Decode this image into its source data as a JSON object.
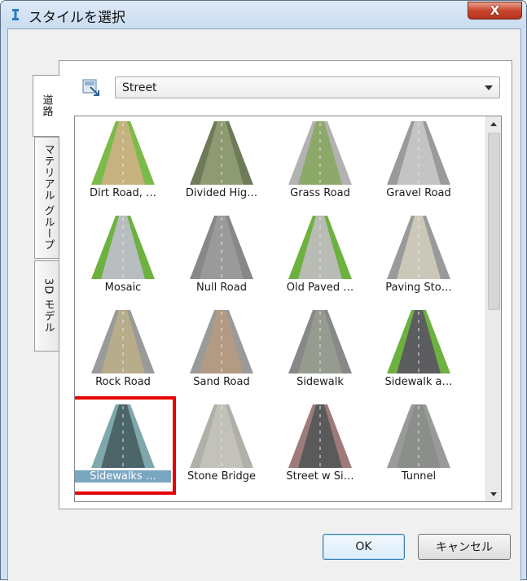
{
  "window": {
    "title": "スタイルを選択",
    "close_label": "X"
  },
  "tabs": [
    {
      "label": "道路",
      "active": true
    },
    {
      "label": "マテリアル グループ",
      "active": false
    },
    {
      "label": "3D モデル",
      "active": false
    }
  ],
  "category": {
    "selected": "Street"
  },
  "styles": [
    {
      "label": "Dirt Road, …",
      "selected": false,
      "center": "#c6b27e",
      "shoulder": "#7bbb4a"
    },
    {
      "label": "Divided Hig…",
      "selected": false,
      "center": "#8e9a72",
      "shoulder": "#6e7a58"
    },
    {
      "label": "Grass Road",
      "selected": false,
      "center": "#8da96a",
      "shoulder": "#b2b2b2"
    },
    {
      "label": "Gravel Road",
      "selected": false,
      "center": "#c3c3c3",
      "shoulder": "#9a9a9a"
    },
    {
      "label": "Mosaic",
      "selected": false,
      "center": "#b8bdbf",
      "shoulder": "#6db13f"
    },
    {
      "label": "Null Road",
      "selected": false,
      "center": "#9a9a9a",
      "shoulder": "#888888"
    },
    {
      "label": "Old Paved …",
      "selected": false,
      "center": "#b9bbb5",
      "shoulder": "#6db13f"
    },
    {
      "label": "Paving Sto…",
      "selected": false,
      "center": "#cbc8b9",
      "shoulder": "#9a9a9a"
    },
    {
      "label": "Rock Road",
      "selected": false,
      "center": "#b8ad8a",
      "shoulder": "#9a9a9a"
    },
    {
      "label": "Sand Road",
      "selected": false,
      "center": "#b39a82",
      "shoulder": "#9a9a9a"
    },
    {
      "label": "Sidewalk",
      "selected": false,
      "center": "#969b8f",
      "shoulder": "#888888"
    },
    {
      "label": "Sidewalk a…",
      "selected": false,
      "center": "#5b5d5f",
      "shoulder": "#6db13f"
    },
    {
      "label": "Sidewalks …",
      "selected": true,
      "center": "#4c6569",
      "shoulder": "#7fa8ad"
    },
    {
      "label": "Stone Bridge",
      "selected": false,
      "center": "#c2c2ba",
      "shoulder": "#b0b0a8"
    },
    {
      "label": "Street w Si…",
      "selected": false,
      "center": "#5a5a5a",
      "shoulder": "#9e7a7a"
    },
    {
      "label": "Tunnel",
      "selected": false,
      "center": "#8a8f8a",
      "shoulder": "#9a9a9a"
    }
  ],
  "buttons": {
    "ok": "OK",
    "cancel": "キャンセル"
  }
}
